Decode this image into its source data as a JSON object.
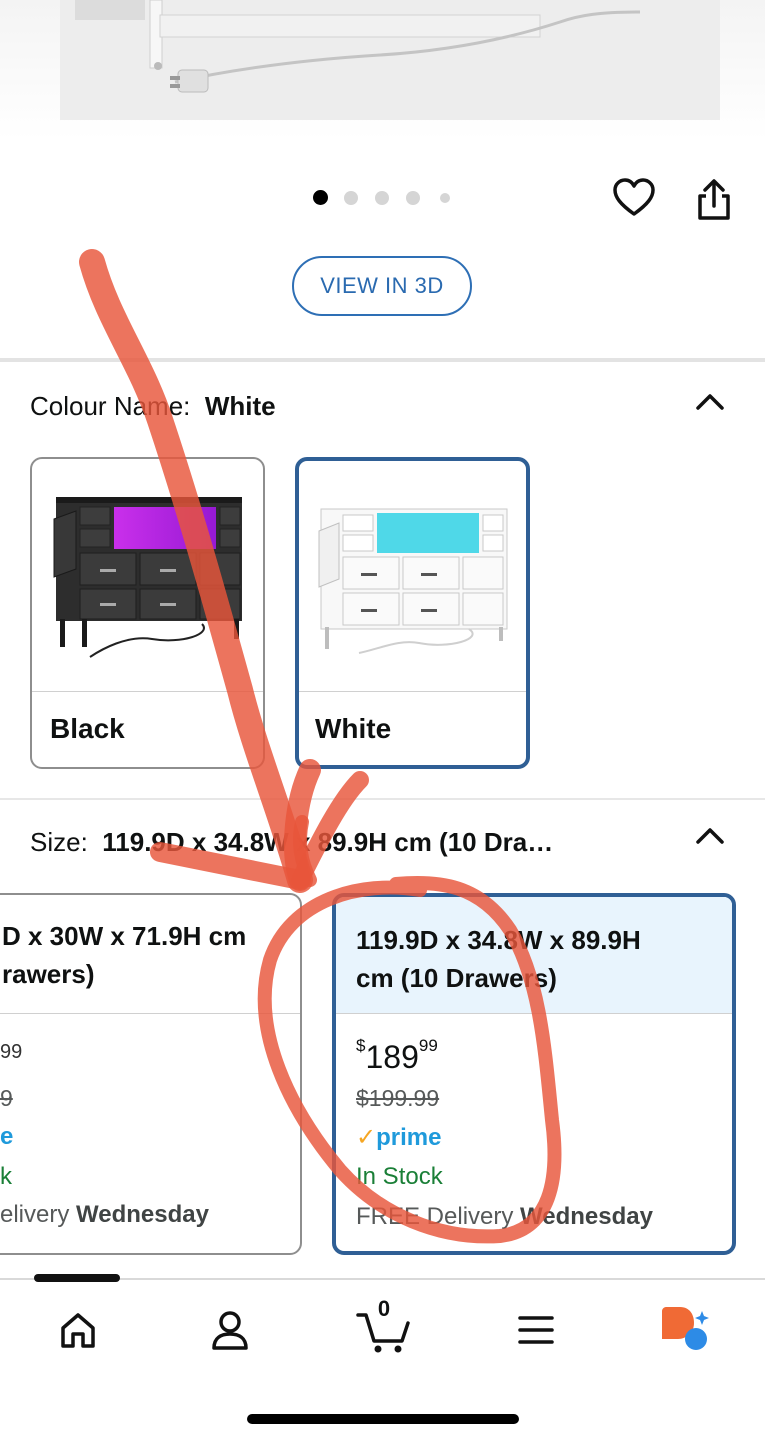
{
  "carousel": {
    "dot_count": 5,
    "active_index": 0
  },
  "actions": {
    "view_3d_label": "VIEW IN 3D"
  },
  "colour": {
    "label": "Colour Name:",
    "selected": "White",
    "options": [
      {
        "label": "Black",
        "selected": false
      },
      {
        "label": "White",
        "selected": true
      }
    ]
  },
  "size": {
    "label": "Size:",
    "selected": "119.9D x 34.8W x 89.9H cm (10 Dra…",
    "options": [
      {
        "title_line1": "D x 30W x 71.9H cm",
        "title_line2": "rawers)",
        "price_fragment": "99",
        "strike_fragment": "9",
        "prime_fragment": "e",
        "stock_fragment": "k",
        "delivery_prefix": "elivery",
        "delivery_day": "Wednesday",
        "selected": false
      },
      {
        "title_line1": "119.9D x 34.8W x 89.9H",
        "title_line2": "cm (10 Drawers)",
        "price_symbol": "$",
        "price_whole": "189",
        "price_fraction": "99",
        "list_price": "$199.99",
        "prime_label": "prime",
        "stock": "In Stock",
        "delivery_prefix": "FREE Delivery",
        "delivery_day": "Wednesday",
        "selected": true
      }
    ]
  },
  "nav": {
    "cart_count": "0"
  },
  "colors": {
    "accent": "#2f5f95",
    "link": "#2a6ab0",
    "stock": "#1a7f37",
    "annotation": "#e8553a",
    "selected_header_bg": "#e8f4fd"
  }
}
